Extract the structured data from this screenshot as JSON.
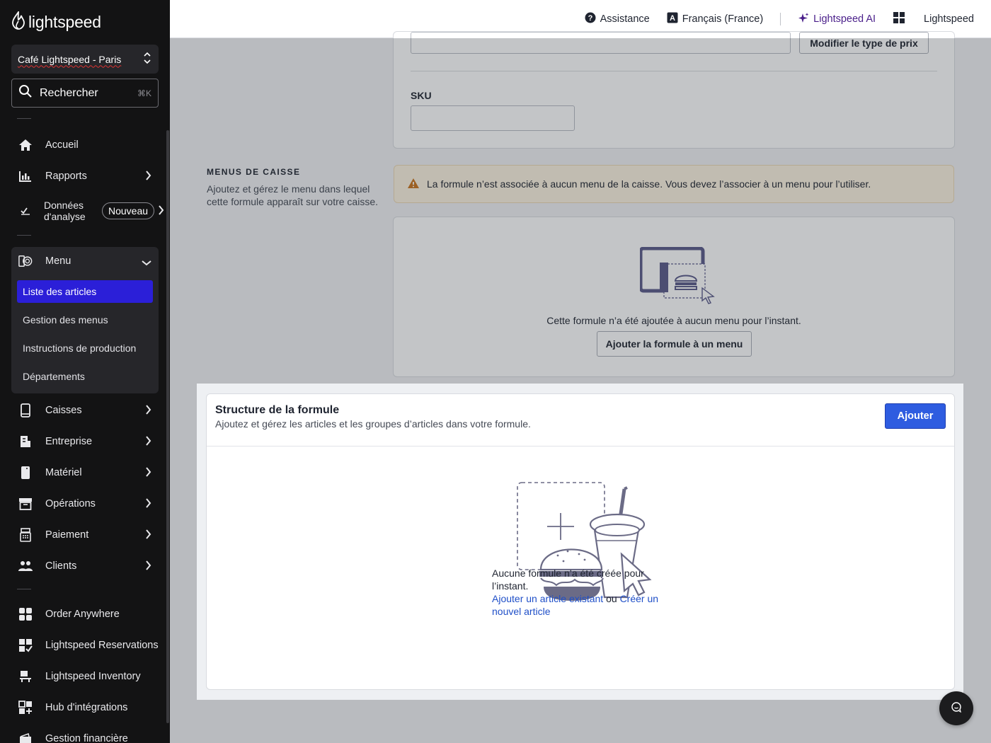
{
  "sidebar": {
    "logo_text": "lightspeed",
    "location": "Café Lightspeed - Paris",
    "search_placeholder": "Rechercher",
    "search_shortcut": "⌘K",
    "items": [
      {
        "label": "Accueil",
        "icon": "home-icon"
      },
      {
        "label": "Rapports",
        "icon": "chart-bar-icon"
      },
      {
        "label": "Données d'analyse",
        "icon": "analytics-icon",
        "badge": "Nouveau"
      },
      {
        "label": "Menu",
        "icon": "menu-book-icon",
        "expanded": true
      },
      {
        "label": "Caisses",
        "icon": "tablet-icon"
      },
      {
        "label": "Entreprise",
        "icon": "document-icon"
      },
      {
        "label": "Matériel",
        "icon": "device-icon"
      },
      {
        "label": "Opérations",
        "icon": "archive-icon"
      },
      {
        "label": "Paiement",
        "icon": "register-icon"
      },
      {
        "label": "Clients",
        "icon": "users-icon"
      },
      {
        "label": "Order Anywhere",
        "icon": "grid-app-icon"
      },
      {
        "label": "Lightspeed Reservations",
        "icon": "grid-check-icon"
      },
      {
        "label": "Lightspeed Inventory",
        "icon": "inventory-icon"
      },
      {
        "label": "Hub d'intégrations",
        "icon": "grid-plus-icon"
      },
      {
        "label": "Gestion financière",
        "icon": "wallet-icon"
      }
    ],
    "menu_subitems": [
      {
        "label": "Liste des articles",
        "active": true
      },
      {
        "label": "Gestion des menus"
      },
      {
        "label": "Instructions de production"
      },
      {
        "label": "Départements"
      }
    ]
  },
  "topbar": {
    "assistance": "Assistance",
    "language": "Français (France)",
    "ai": "Lightspeed AI",
    "account": "Lightspeed"
  },
  "pricing": {
    "change_price_type": "Modifier le type de prix",
    "sku_label": "SKU",
    "sku_value": ""
  },
  "menus_caisse": {
    "title": "MENUS DE CAISSE",
    "description": "Ajoutez et gérez le menu dans lequel cette formule apparaît sur votre caisse.",
    "warning": "La formule n’est associée à aucun menu de la caisse. Vous devez l’associer à un menu pour l’utiliser.",
    "empty_text": "Cette formule n’a été ajoutée à aucun menu pour l’instant.",
    "add_button": "Ajouter la formule à un menu"
  },
  "structure": {
    "title": "Structure de la formule",
    "subtitle": "Ajoutez et gérez les articles et les groupes d’articles dans votre formule.",
    "add_button": "Ajouter",
    "empty_text": "Aucune formule n’a été créée pour l’instant.",
    "link_existing": "Ajouter un article existant",
    "or": "ou",
    "link_new": "Créer un nouvel article"
  },
  "colors": {
    "sidebar_bg": "#131314",
    "active_item": "#2b1fd8",
    "primary_button": "#2e5ce0",
    "warning_bg": "#fdf3e1",
    "warning_icon": "#c9731c",
    "ai_accent": "#4a1f8a"
  }
}
